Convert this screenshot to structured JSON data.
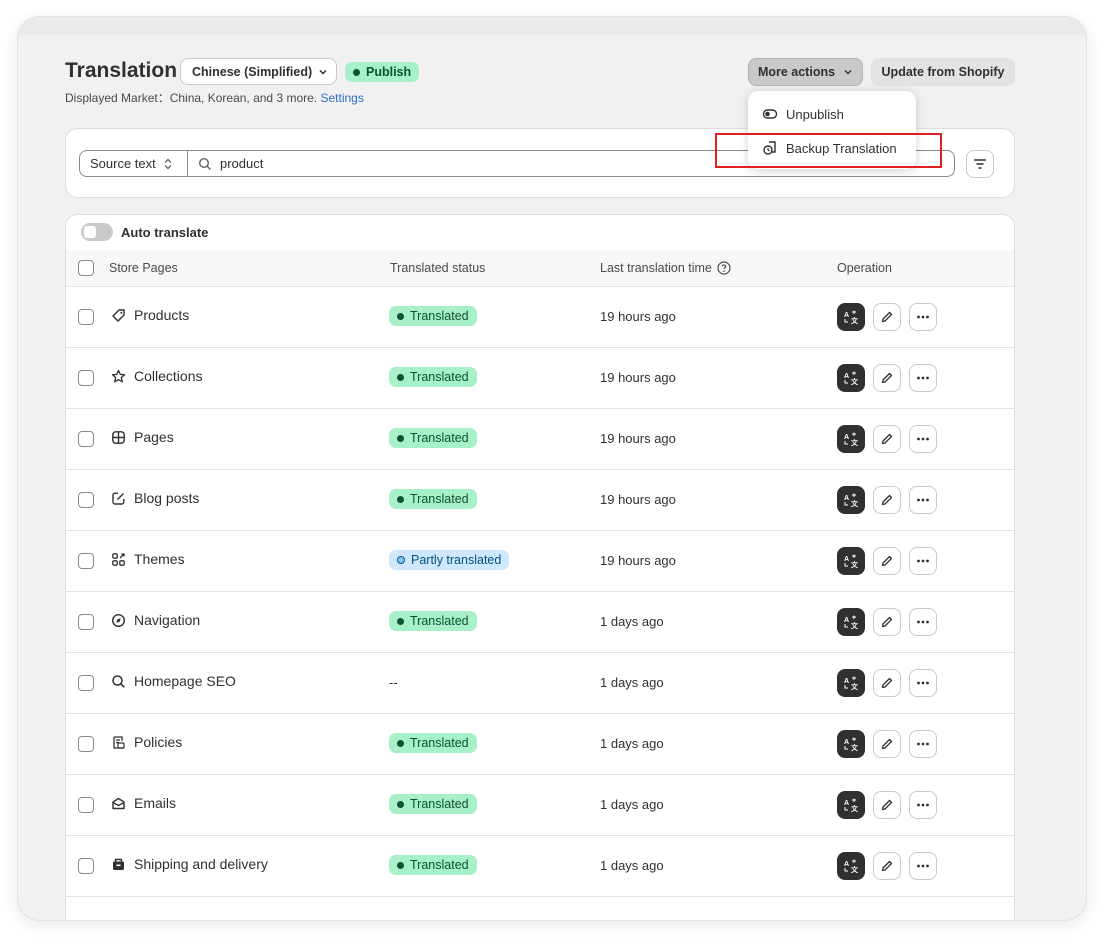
{
  "header": {
    "title": "Translation",
    "language": "Chinese (Simplified)",
    "publish_badge": "Publish",
    "market_prefix": "Displayed Market：China, Korean, and 3 more.",
    "settings_link": "Settings",
    "more_actions": "More actions",
    "update_button": "Update from Shopify"
  },
  "menu": {
    "unpublish": "Unpublish",
    "backup": "Backup Translation"
  },
  "search": {
    "source_select": "Source text",
    "query": "product"
  },
  "table": {
    "auto_translate": "Auto translate",
    "columns": [
      "Store Pages",
      "Translated status",
      "Last translation time",
      "Operation"
    ],
    "rows": [
      {
        "name": "Products",
        "icon": "tag-icon",
        "status": "Translated",
        "time": "19 hours ago"
      },
      {
        "name": "Collections",
        "icon": "star-icon",
        "status": "Translated",
        "time": "19 hours ago"
      },
      {
        "name": "Pages",
        "icon": "layout-icon",
        "status": "Translated",
        "time": "19 hours ago"
      },
      {
        "name": "Blog posts",
        "icon": "edit-square-icon",
        "status": "Translated",
        "time": "19 hours ago"
      },
      {
        "name": "Themes",
        "icon": "apps-icon",
        "status": "Partly translated",
        "time": "19 hours ago"
      },
      {
        "name": "Navigation",
        "icon": "compass-icon",
        "status": "Translated",
        "time": "1 days ago"
      },
      {
        "name": "Homepage SEO",
        "icon": "search-icon",
        "status": "--",
        "time": "1 days ago"
      },
      {
        "name": "Policies",
        "icon": "policy-icon",
        "status": "Translated",
        "time": "1 days ago"
      },
      {
        "name": "Emails",
        "icon": "mail-icon",
        "status": "Translated",
        "time": "1 days ago"
      },
      {
        "name": "Shipping and delivery",
        "icon": "truck-icon",
        "status": "Translated",
        "time": "1 days ago"
      }
    ]
  },
  "colors": {
    "translated_bg": "#a8f0c8",
    "partly_bg": "#cfe7ff",
    "highlight": "#e0201f",
    "link": "#2c6ecb"
  }
}
